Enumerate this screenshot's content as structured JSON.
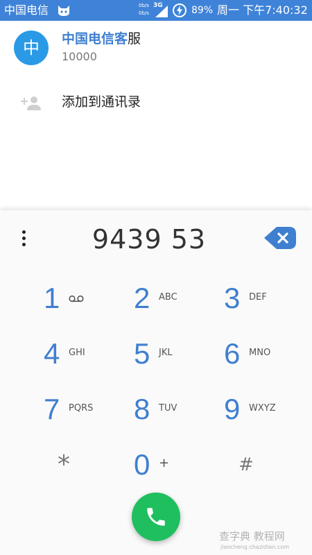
{
  "status_bar": {
    "carrier": "中国电信",
    "net_up": "0b/s",
    "net_down": "0b/s",
    "network_type": "3G",
    "battery_percent": "89%",
    "datetime": "周一 下午7:40:32",
    "icons": [
      "cat-icon",
      "signal-icon",
      "battery-charging-icon"
    ]
  },
  "suggestion": {
    "avatar_letter": "中",
    "name_highlight": "中国电信客",
    "name_rest": "服",
    "number": "10000",
    "add_to_contacts": "添加到通讯录"
  },
  "dialpad": {
    "digits": "9439 53",
    "keys": [
      {
        "num": "1",
        "letters": ""
      },
      {
        "num": "2",
        "letters": "ABC"
      },
      {
        "num": "3",
        "letters": "DEF"
      },
      {
        "num": "4",
        "letters": "GHI"
      },
      {
        "num": "5",
        "letters": "JKL"
      },
      {
        "num": "6",
        "letters": "MNO"
      },
      {
        "num": "7",
        "letters": "PQRS"
      },
      {
        "num": "8",
        "letters": "TUV"
      },
      {
        "num": "9",
        "letters": "WXYZ"
      },
      {
        "num": "*",
        "letters": ""
      },
      {
        "num": "0",
        "letters": "+"
      },
      {
        "num": "#",
        "letters": ""
      }
    ]
  },
  "watermark": {
    "text": "查字典 教程网",
    "sub": "jiaocheng.chazidian.com"
  },
  "colors": {
    "status_bar": "#3f83d8",
    "accent_blue": "#3f7fd0",
    "call_green": "#1fbf5f",
    "avatar_blue": "#2b9ae6"
  }
}
